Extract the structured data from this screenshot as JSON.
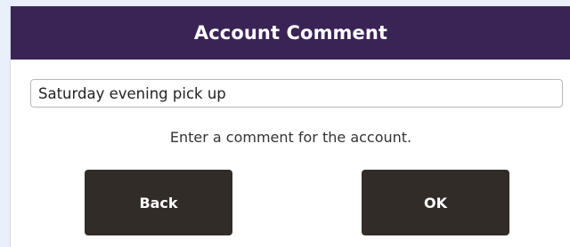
{
  "dialog": {
    "title": "Account Comment",
    "comment_value": "Saturday evening pick up",
    "instruction": "Enter a comment for the account.",
    "back_label": "Back",
    "ok_label": "OK"
  },
  "colors": {
    "title_bar": "#3a2456",
    "button": "#322c29",
    "page_background": "#e9f0fb"
  }
}
